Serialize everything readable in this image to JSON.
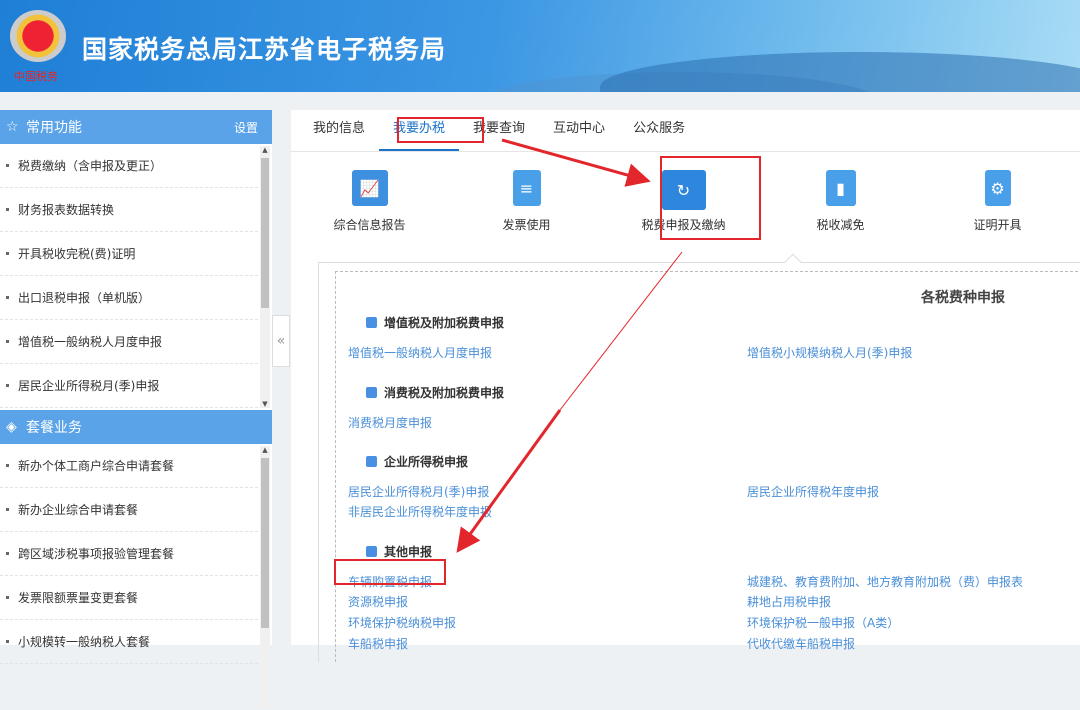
{
  "header": {
    "title": "国家税务总局江苏省电子税务局",
    "seal_text": "中国税务"
  },
  "sidebar": {
    "common": {
      "title": "常用功能",
      "settings": "设置",
      "items": [
        "税费缴纳（含申报及更正）",
        "财务报表数据转换",
        "开具税收完税(费)证明",
        "出口退税申报（单机版）",
        "增值税一般纳税人月度申报",
        "居民企业所得税月(季)申报"
      ]
    },
    "packages": {
      "title": "套餐业务",
      "items": [
        "新办个体工商户综合申请套餐",
        "新办企业综合申请套餐",
        "跨区域涉税事项报验管理套餐",
        "发票限额票量变更套餐",
        "小规模转一般纳税人套餐"
      ]
    },
    "collapse": "«"
  },
  "tabs": [
    "我的信息",
    "我要办税",
    "我要查询",
    "互动中心",
    "公众服务"
  ],
  "active_tab": "我要办税",
  "icons": [
    "综合信息报告",
    "发票使用",
    "税费申报及缴纳",
    "税收减免",
    "证明开具"
  ],
  "panel": {
    "title": "各税费种申报",
    "groups": [
      {
        "title": "增值税及附加税费申报",
        "left": [
          "增值税一般纳税人月度申报"
        ],
        "right": [
          "增值税小规模纳税人月(季)申报"
        ]
      },
      {
        "title": "消费税及附加税费申报",
        "left": [
          "消费税月度申报"
        ],
        "right": []
      },
      {
        "title": "企业所得税申报",
        "left": [
          "居民企业所得税月(季)申报",
          "非居民企业所得税年度申报"
        ],
        "right": [
          "居民企业所得税年度申报"
        ]
      },
      {
        "title": "其他申报",
        "left": [
          "车辆购置税申报",
          "资源税申报",
          "环境保护税纳税申报",
          "车船税申报"
        ],
        "right": [
          "城建税、教育费附加、地方教育附加税（费）申报表",
          "耕地占用税申报",
          "环境保护税一般申报（A类）",
          "代收代缴车船税申报"
        ]
      }
    ]
  },
  "colors": {
    "accent": "#1a73c9",
    "highlight": "#e3262b",
    "link": "#4a8fd8"
  }
}
